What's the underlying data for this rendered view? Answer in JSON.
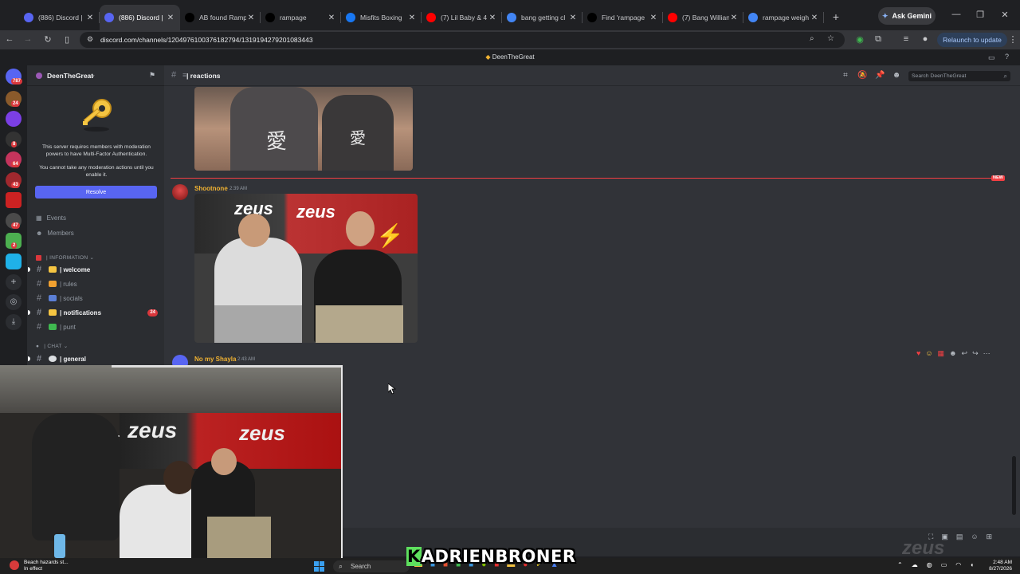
{
  "browser": {
    "tabs": [
      {
        "title": "(886) Discord |",
        "favicon_color": "#5865f2",
        "favicon": "discord-icon"
      },
      {
        "title": "(886) Discord |",
        "favicon_color": "#5865f2",
        "favicon": "discord-icon",
        "active": true
      },
      {
        "title": "AB found Ramp",
        "favicon_color": "#000000",
        "favicon": "tiktok-icon"
      },
      {
        "title": "rampage",
        "favicon_color": "#000000",
        "favicon": "tiktok-icon"
      },
      {
        "title": "Misfits Boxing",
        "favicon_color": "#1877f2",
        "favicon": "facebook-icon"
      },
      {
        "title": "(7) Lil Baby & 4",
        "favicon_color": "#ff0000",
        "favicon": "youtube-icon"
      },
      {
        "title": "bang getting cl",
        "favicon_color": "#4285f4",
        "favicon": "google-icon"
      },
      {
        "title": "Find 'rampage",
        "favicon_color": "#000000",
        "favicon": "tiktok-icon"
      },
      {
        "title": "(7) Bang Willian",
        "favicon_color": "#ff0000",
        "favicon": "youtube-icon"
      },
      {
        "title": "rampage weigh",
        "favicon_color": "#4285f4",
        "favicon": "google-icon"
      }
    ],
    "gemini_label": "Ask Gemini",
    "url": "discord.com/channels/1204976100376182794/1319194279201083443",
    "relaunch_label": "Relaunch to update"
  },
  "discord": {
    "window_title": "DeenTheGreat",
    "server_name": "DeenTheGreat",
    "mfa_message": "This server requires members with moderation powers to have Multi-Factor Authentication.",
    "mfa_message2": "You cannot take any moderation actions until you enable it.",
    "resolve_label": "Resolve",
    "events_label": "Events",
    "members_label": "Members",
    "category_information": "| INFORMATION",
    "category_chat": "| CHAT",
    "channels": [
      {
        "name": "| welcome",
        "emoji_color": "#f5c542",
        "unread": true
      },
      {
        "name": "| rules",
        "emoji_color": "#f0a030",
        "unread": false
      },
      {
        "name": "| socials",
        "emoji_color": "#5b7fd6",
        "unread": false
      },
      {
        "name": "| notifications",
        "emoji_color": "#f5c542",
        "unread": true,
        "badge": "24"
      },
      {
        "name": "| punt",
        "emoji_color": "#3fb950",
        "unread": false
      }
    ],
    "chat_channel": {
      "name": "| general"
    },
    "current_channel": "| reactions",
    "search_placeholder": "Search DeenTheGreat",
    "server_badges": [
      "787",
      "24",
      "8",
      "64",
      "43",
      "47",
      "2"
    ],
    "messages": [
      {
        "author": "Shootnone",
        "time": "2:39 AM",
        "color": "#f0b232"
      },
      {
        "author": "No my Shayla",
        "time": "2:43 AM",
        "color": "#f0b232"
      }
    ],
    "new_label": "NEW"
  },
  "overlay": {
    "caption_k": "K",
    "caption": "ADRIENBRONER",
    "watermark": "zeus"
  },
  "taskbar": {
    "weather_title": "Beach hazards st...",
    "weather_sub": "In effect",
    "search_label": "Search",
    "time": "2:48 AM",
    "date": "8/27/2026"
  }
}
